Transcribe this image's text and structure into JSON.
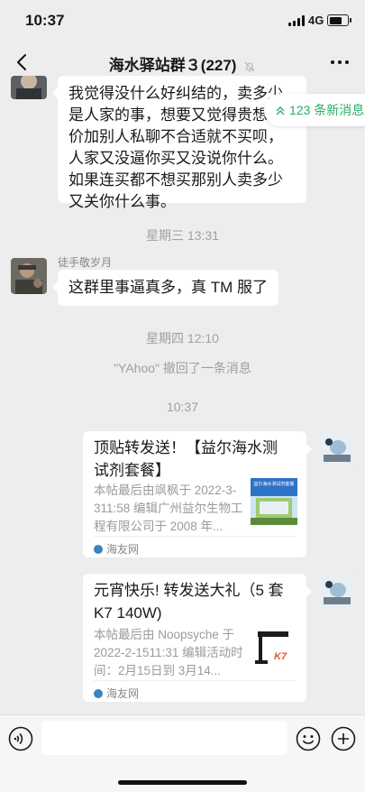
{
  "status": {
    "time": "10:37",
    "network": "4G",
    "battery_level": 0.65
  },
  "header": {
    "title": "海水驿站群３(227)",
    "muted": true
  },
  "new_messages_label": "123 条新消息",
  "messages": [
    {
      "type": "text",
      "text": "我觉得没什么好纠结的，卖多少是人家的事，想要又觉得贵想砍价加别人私聊不合适就不买呗，人家又没逼你买又没说你什么。如果连买都不想买那别人卖多少又关你什么事。"
    },
    {
      "type": "time",
      "text": "星期三 13:31"
    },
    {
      "type": "text",
      "sender": "徒手敬岁月",
      "text": "这群里事逼真多，真 TM 服了"
    },
    {
      "type": "time",
      "text": "星期四 12:10"
    },
    {
      "type": "system",
      "text": "\"YAhoo\" 撤回了一条消息"
    },
    {
      "type": "time",
      "text": "10:37"
    },
    {
      "type": "link",
      "title": "顶贴转发送！【益尔海水测试剂套餐】",
      "desc": "本帖最后由飒枫于 2022-3-311:58 编辑广州益尔生物工程有限公司于 2008 年...",
      "thumb_text": "益尔海水测试剂套餐",
      "source": "海友网"
    },
    {
      "type": "link",
      "title": "元宵快乐! 转发送大礼（5 套 K7 140W)",
      "desc": "本帖最后由 Noopsyche 于 2022-2-1511:31 编辑活动时间：2月15日到 3月14...",
      "thumb_text": "K7",
      "source": "海友网"
    }
  ],
  "colors": {
    "accent": "#2aae67",
    "bg": "#ededed"
  }
}
